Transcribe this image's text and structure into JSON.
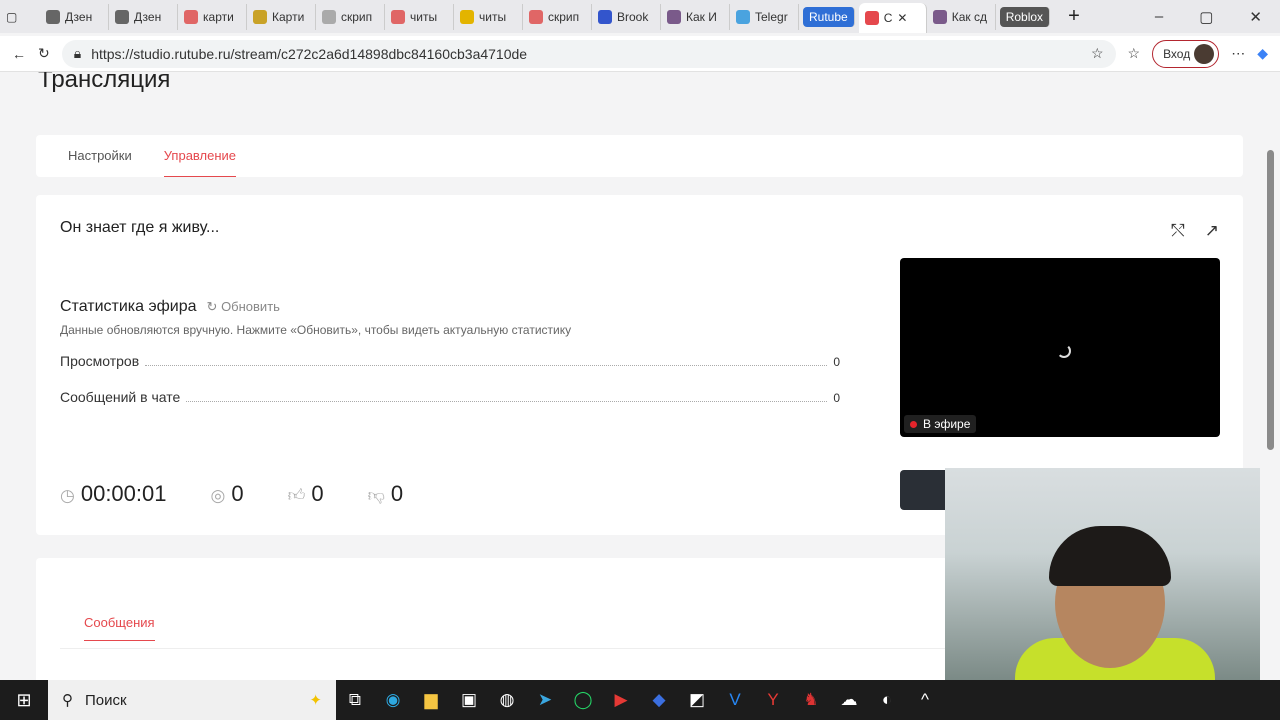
{
  "browser": {
    "tabs": [
      {
        "label": "Дзен",
        "color": "#666"
      },
      {
        "label": "Дзен",
        "color": "#666"
      },
      {
        "label": "карти",
        "color": "#e06666"
      },
      {
        "label": "Карти",
        "color": "#c9a227"
      },
      {
        "label": "скрип",
        "color": "#aaa"
      },
      {
        "label": "читы",
        "color": "#e06666"
      },
      {
        "label": "читы",
        "color": "#e3b400"
      },
      {
        "label": "скрип",
        "color": "#e06666"
      },
      {
        "label": "Brook",
        "color": "#3355cc"
      },
      {
        "label": "Как И",
        "color": "#7a5a8a"
      },
      {
        "label": "Telegr",
        "color": "#4aa3df"
      }
    ],
    "pill_tab": "Rutube",
    "active_tab": "С",
    "after_tab": "Как сд",
    "roblox_tab": "Roblox",
    "url": "https://studio.rutube.ru/stream/c272c2a6d14898dbc84160cb3a4710de",
    "login": "Вход"
  },
  "page": {
    "heading": "Трансляция",
    "tabs": [
      "Настройки",
      "Управление"
    ],
    "stream_title": "Он знает где я живу...",
    "stats_title": "Статистика эфира",
    "refresh": "Обновить",
    "note": "Данные обновляются вручную. Нажмите «Обновить», чтобы видеть актуальную статистику",
    "rows": [
      {
        "label": "Просмотров",
        "value": "0"
      },
      {
        "label": "Сообщений в чате",
        "value": "0"
      }
    ],
    "live": "В эфире",
    "metrics": {
      "time": "00:00:01",
      "viewers": "0",
      "likes": "0",
      "dislikes": "0"
    },
    "messages_tab": "Сообщения"
  },
  "taskbar": {
    "search": "Поиск"
  },
  "colors": {
    "accent": "#e5484d",
    "live": "#e5242b"
  }
}
